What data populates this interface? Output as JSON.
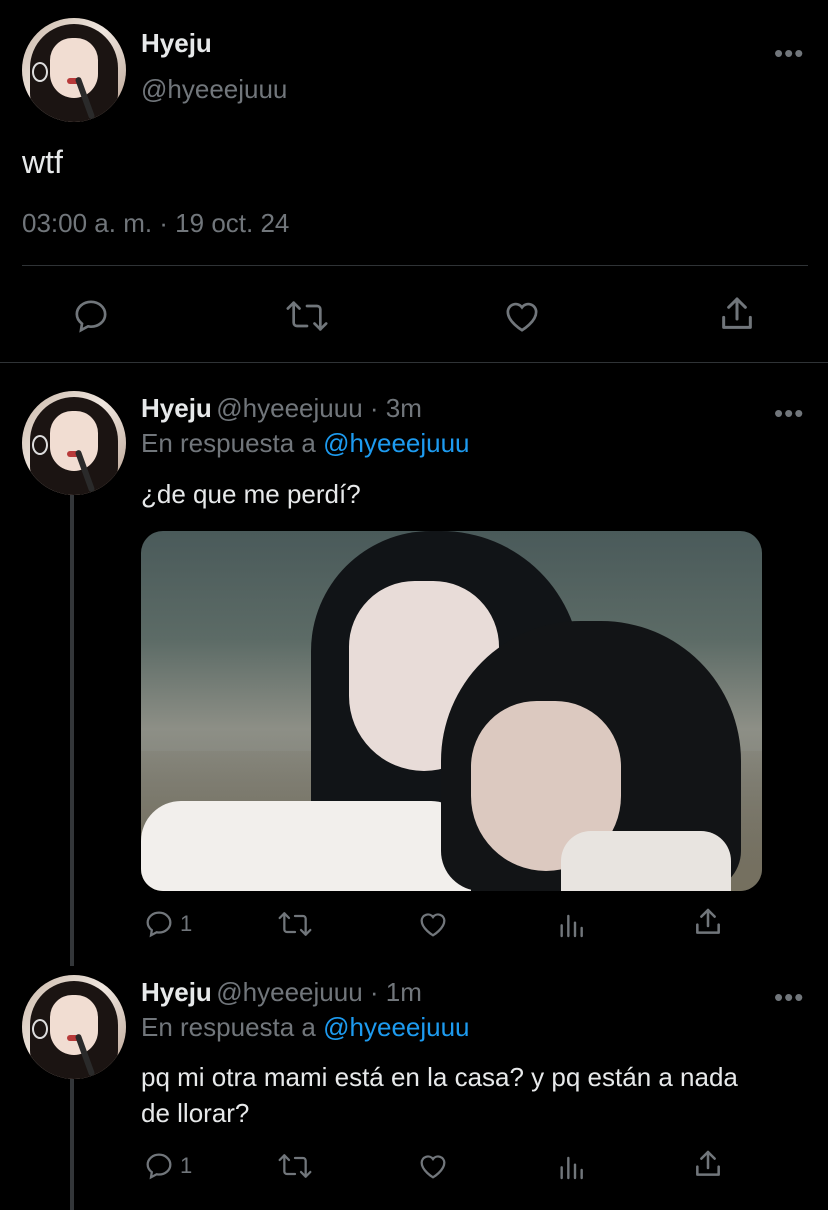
{
  "main_tweet": {
    "name": "Hyeju",
    "handle": "@hyeeejuuu",
    "more": "•••",
    "text": "wtf",
    "timestamp": "03:00 a. m. · 19 oct. 24"
  },
  "replies": [
    {
      "name": "Hyeju",
      "meta": "@hyeeejuuu · 3m",
      "reply_prefix": "En respuesta a",
      "reply_to": "@hyeeejuuu",
      "more": "•••",
      "text": "¿de que me perdí?",
      "reply_count": "1"
    },
    {
      "name": "Hyeju",
      "meta": "@hyeeejuuu · 1m",
      "reply_prefix": "En respuesta a",
      "reply_to": "@hyeeejuuu",
      "more": "•••",
      "text": "pq mi otra mami está en la casa? y pq están a nada de llorar?",
      "reply_count": "1"
    }
  ],
  "icons": [
    "reply-icon",
    "retweet-icon",
    "like-icon",
    "views-icon",
    "share-icon",
    "more-icon"
  ],
  "colors": {
    "background": "#000000",
    "text": "#e7e9ea",
    "muted": "#71767b",
    "link": "#1d9bf0",
    "divider": "#2f3336"
  }
}
